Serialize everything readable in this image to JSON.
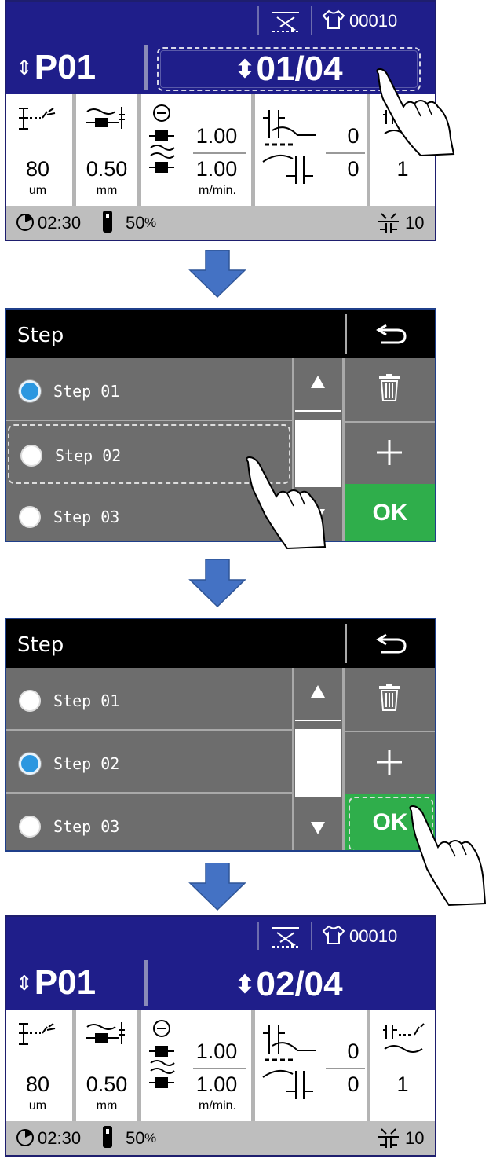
{
  "screen1": {
    "counter": "00010",
    "program": "P01",
    "step_indicator": "01/04",
    "cell_stitch_value": "80",
    "cell_stitch_unit": "um",
    "cell_thread_value": "0.50",
    "cell_thread_unit": "mm",
    "feed_upper_value": "1.00",
    "feed_lower_value": "1.00",
    "feed_unit": "m/min.",
    "offset_upper_value": "0",
    "offset_lower_value": "0",
    "last_value": "1",
    "time": "02:30",
    "percent": "50",
    "percent_unit": "%",
    "stitch_count": "10"
  },
  "dialog1": {
    "title": "Step",
    "items": [
      {
        "label": "Step 01",
        "selected": true
      },
      {
        "label": "Step 02",
        "selected": false
      },
      {
        "label": "Step 03",
        "selected": false
      }
    ],
    "ok_label": "OK"
  },
  "dialog2": {
    "title": "Step",
    "items": [
      {
        "label": "Step 01",
        "selected": false
      },
      {
        "label": "Step 02",
        "selected": true
      },
      {
        "label": "Step 03",
        "selected": false
      }
    ],
    "ok_label": "OK"
  },
  "screen2": {
    "counter": "00010",
    "program": "P01",
    "step_indicator": "02/04",
    "cell_stitch_value": "80",
    "cell_stitch_unit": "um",
    "cell_thread_value": "0.50",
    "cell_thread_unit": "mm",
    "feed_upper_value": "1.00",
    "feed_lower_value": "1.00",
    "feed_unit": "m/min.",
    "offset_upper_value": "0",
    "offset_lower_value": "0",
    "last_value": "1",
    "time": "02:30",
    "percent": "50",
    "percent_unit": "%",
    "stitch_count": "10"
  },
  "colors": {
    "header_blue": "#1f1e8a",
    "ok_green": "#2fae4b",
    "radio_selected": "#2b97e0",
    "arrow_blue": "#4472c4",
    "dialog_gray": "#6d6d6d"
  },
  "icons": [
    "needle-threading-icon",
    "shirt-icon",
    "stitch-icon",
    "thread-tension-icon",
    "feed-speed-icon",
    "offset-icon",
    "clock-icon",
    "thermometer-icon",
    "back-icon",
    "trash-icon",
    "plus-icon",
    "arrow-up-icon",
    "arrow-down-icon",
    "hand-pointer-icon"
  ]
}
